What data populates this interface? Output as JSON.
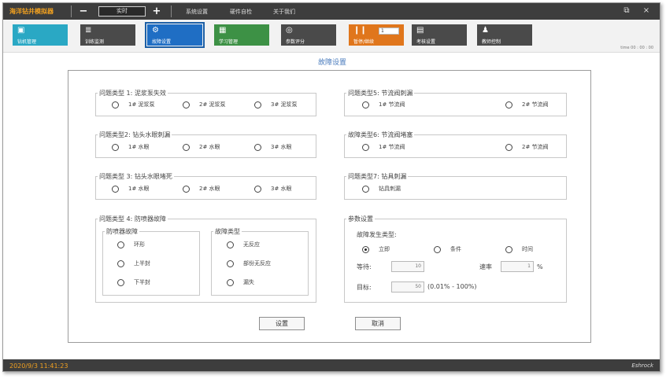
{
  "titlebar": {
    "app_title": "海洋钻井模拟器",
    "minus_label": "−",
    "speed_value": "实时",
    "plus_label": "+",
    "menu": [
      "系统设置",
      "硬件自检",
      "关于我们"
    ],
    "restore_icon": "⧉",
    "close_icon": "×"
  },
  "toolbar": {
    "tools": [
      {
        "label": "钻机管理",
        "icon": "▣",
        "color": "#2aa8c4"
      },
      {
        "label": "训练监测",
        "icon": "≣",
        "color": "#4a4a4a"
      },
      {
        "label": "故障设置",
        "icon": "⚙",
        "color": "#1f6ec4"
      },
      {
        "label": "学习管理",
        "icon": "▦",
        "color": "#3d9145"
      },
      {
        "label": "参数评分",
        "icon": "◎",
        "color": "#4a4a4a"
      },
      {
        "label": "暂停/继续",
        "icon": "❙❙",
        "color": "#e0761c",
        "input": "1"
      },
      {
        "label": "考核设置",
        "icon": "▤",
        "color": "#4a4a4a"
      },
      {
        "label": "教师控制",
        "icon": "♟",
        "color": "#4a4a4a"
      }
    ],
    "timestamp": "time 00 : 00 : 00"
  },
  "page_title": "故障设置",
  "groups": {
    "g1": {
      "title": "问题类型 1: 泥浆泵失效",
      "options": [
        "1# 泥浆泵",
        "2# 泥浆泵",
        "3# 泥浆泵"
      ]
    },
    "g2": {
      "title": "问题类型2: 钻头水眼刺漏",
      "options": [
        "1# 水眼",
        "2# 水眼",
        "3# 水眼"
      ]
    },
    "g3": {
      "title": "问题类型 3: 钻头水眼堵死",
      "options": [
        "1# 水眼",
        "2# 水眼",
        "3# 水眼"
      ]
    },
    "g4": {
      "title": "问题类型 4: 防喷器故障",
      "sub1": {
        "title": "防喷器故障",
        "options": [
          "环形",
          "上半封",
          "下半封"
        ]
      },
      "sub2": {
        "title": "故障类型",
        "options": [
          "无反应",
          "部份无反应",
          "漏失"
        ]
      }
    },
    "g5": {
      "title": "问题类型5: 节流阀刺漏",
      "options": [
        "1# 节流阀",
        "2# 节流阀"
      ]
    },
    "g6": {
      "title": "故障类型6: 节流阀堵塞",
      "options": [
        "1# 节流阀",
        "2# 节流阀"
      ]
    },
    "g7": {
      "title": "问题类型7: 钻具刺漏",
      "options": [
        "钻具刺漏"
      ]
    },
    "params": {
      "title": "参数设置",
      "trigger_label": "故障发生类型:",
      "trigger_options": [
        "立即",
        "条件",
        "时间"
      ],
      "wait_label": "等待:",
      "wait_value": "10",
      "rate_label": "速率",
      "rate_value": "1",
      "rate_unit": "%",
      "target_label": "目标:",
      "target_value": "50",
      "range_text": "(0.01% - 100%)"
    }
  },
  "buttons": {
    "ok": "设置",
    "cancel": "取消"
  },
  "status": {
    "time": "2020/9/3 11:41:23",
    "brand": "Eshrock"
  }
}
